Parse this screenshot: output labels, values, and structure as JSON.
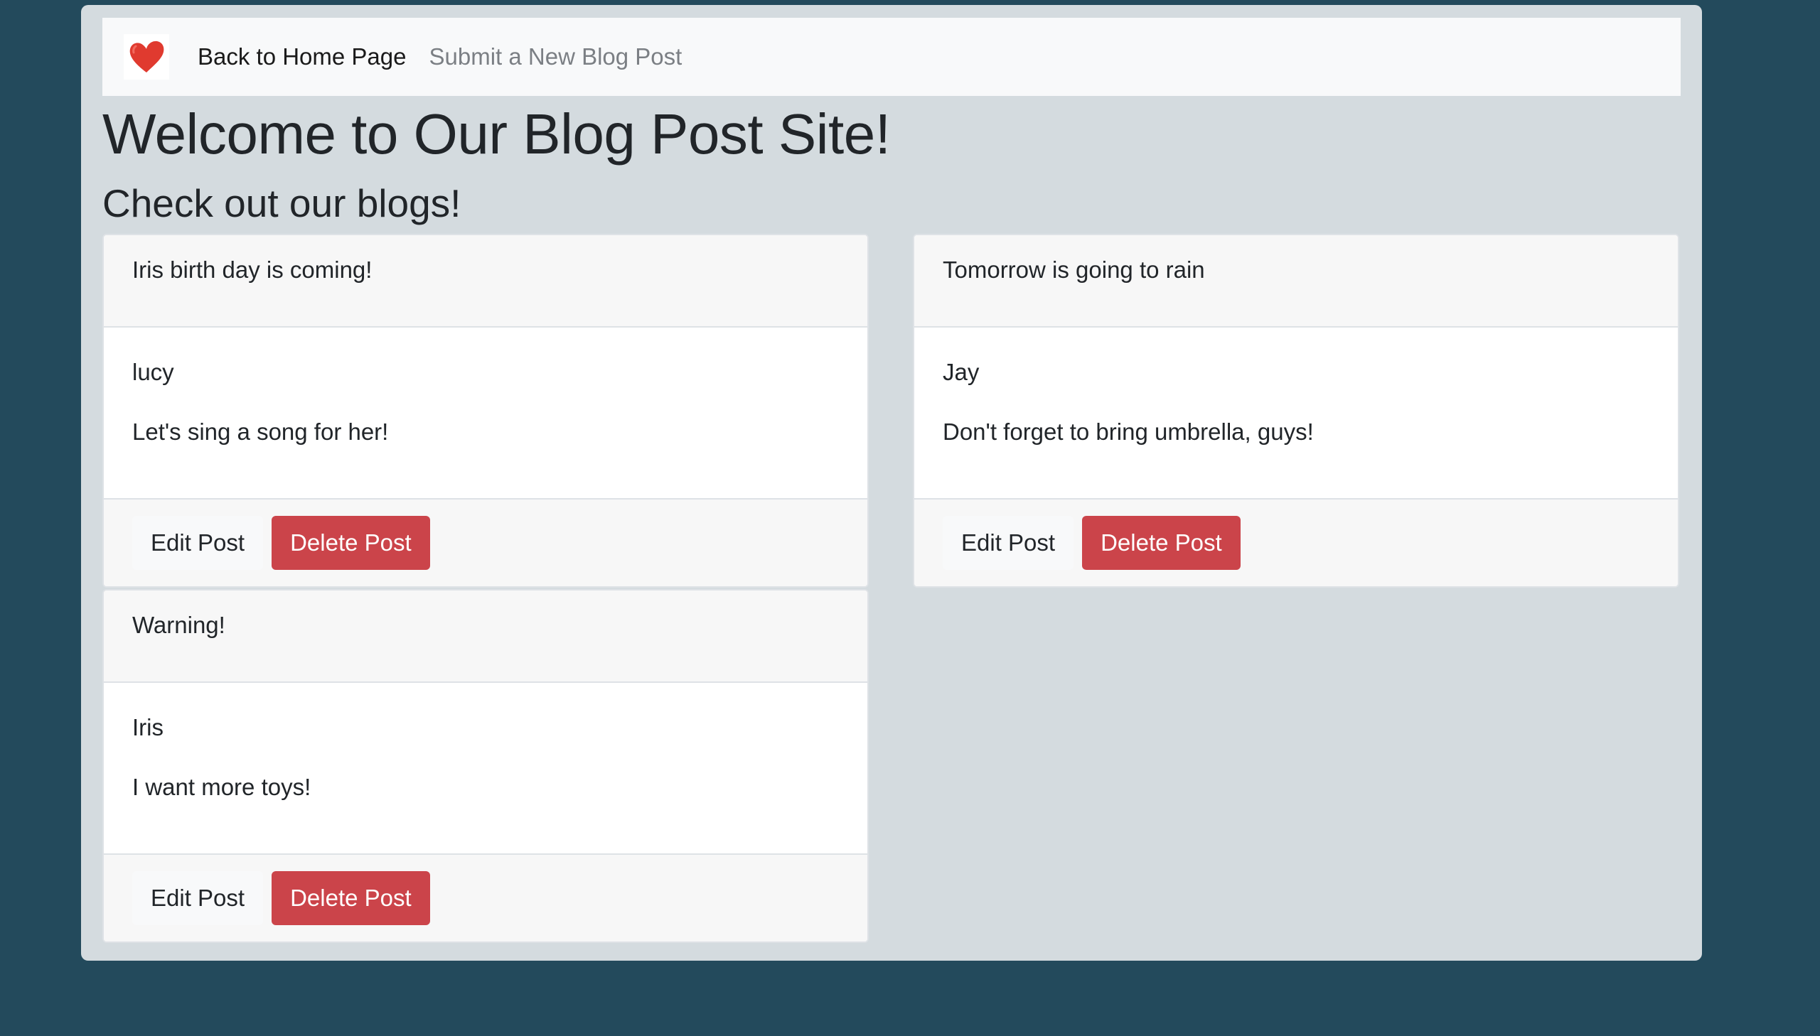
{
  "navbar": {
    "logo_icon": "heart-icon",
    "logo_color": "#e03a2f",
    "home_link": "Back to Home Page",
    "submit_link": "Submit a New Blog Post"
  },
  "main": {
    "title": "Welcome to Our Blog Post Site!",
    "subtitle": "Check out our blogs!"
  },
  "posts": [
    {
      "title": "Iris birth day is coming!",
      "author": "lucy",
      "content": "Let's sing a song for her!",
      "edit_label": "Edit Post",
      "delete_label": "Delete Post"
    },
    {
      "title": "Tomorrow is going to rain",
      "author": "Jay",
      "content": "Don't forget to bring umbrella, guys!",
      "edit_label": "Edit Post",
      "delete_label": "Delete Post"
    },
    {
      "title": "Warning!",
      "author": "Iris",
      "content": "I want more toys!",
      "edit_label": "Edit Post",
      "delete_label": "Delete Post"
    }
  ],
  "colors": {
    "page_bg": "#234a5c",
    "container_bg": "#d4dbdf",
    "danger": "#cb444a"
  }
}
